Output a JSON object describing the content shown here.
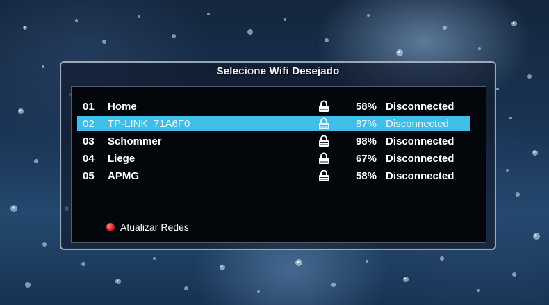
{
  "dialog": {
    "title": "Selecione Wifi Desejado"
  },
  "networks": [
    {
      "num": "01",
      "name": "Home",
      "signal": "58%",
      "status": "Disconnected",
      "locked": true,
      "selected": false
    },
    {
      "num": "02",
      "name": "TP-LINK_71A6F0",
      "signal": "87%",
      "status": "Disconnected",
      "locked": true,
      "selected": true
    },
    {
      "num": "03",
      "name": "Schommer",
      "signal": "98%",
      "status": "Disconnected",
      "locked": true,
      "selected": false
    },
    {
      "num": "04",
      "name": "Liege",
      "signal": "67%",
      "status": "Disconnected",
      "locked": true,
      "selected": false
    },
    {
      "num": "05",
      "name": "APMG",
      "signal": "58%",
      "status": "Disconnected",
      "locked": true,
      "selected": false
    }
  ],
  "footer": {
    "red_button_label": "Atualizar Redes",
    "red_button_icon": "red-button-icon"
  },
  "colors": {
    "selection": "#3fbfe8",
    "text": "#ffffff",
    "red_key": "#d31818"
  }
}
